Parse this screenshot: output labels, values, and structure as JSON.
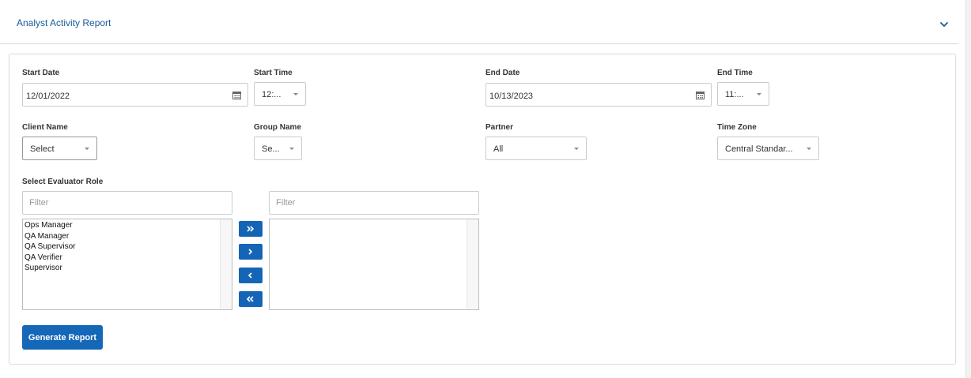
{
  "header": {
    "title": "Analyst Activity Report",
    "chevron_icon": "chevron-down-icon"
  },
  "form": {
    "start_date": {
      "label": "Start Date",
      "value": "12/01/2022",
      "icon": "calendar-icon"
    },
    "start_time": {
      "label": "Start Time",
      "value": "12:..."
    },
    "end_date": {
      "label": "End Date",
      "value": "10/13/2023",
      "icon": "calendar-icon"
    },
    "end_time": {
      "label": "End Time",
      "value": "11:..."
    },
    "client_name": {
      "label": "Client Name",
      "value": "Select"
    },
    "group_name": {
      "label": "Group Name",
      "value": "Se..."
    },
    "partner": {
      "label": "Partner",
      "value": "All"
    },
    "time_zone": {
      "label": "Time Zone",
      "value": "Central Standar..."
    },
    "evaluator_role": {
      "label": "Select Evaluator Role",
      "left_filter_placeholder": "Filter",
      "right_filter_placeholder": "Filter",
      "available": [
        "Ops Manager",
        "QA Manager",
        "QA Supervisor",
        "QA Verifier",
        "Supervisor"
      ],
      "selected": []
    },
    "generate_button": "Generate Report"
  },
  "colors": {
    "accent": "#1565b7",
    "title": "#1a5a99"
  }
}
